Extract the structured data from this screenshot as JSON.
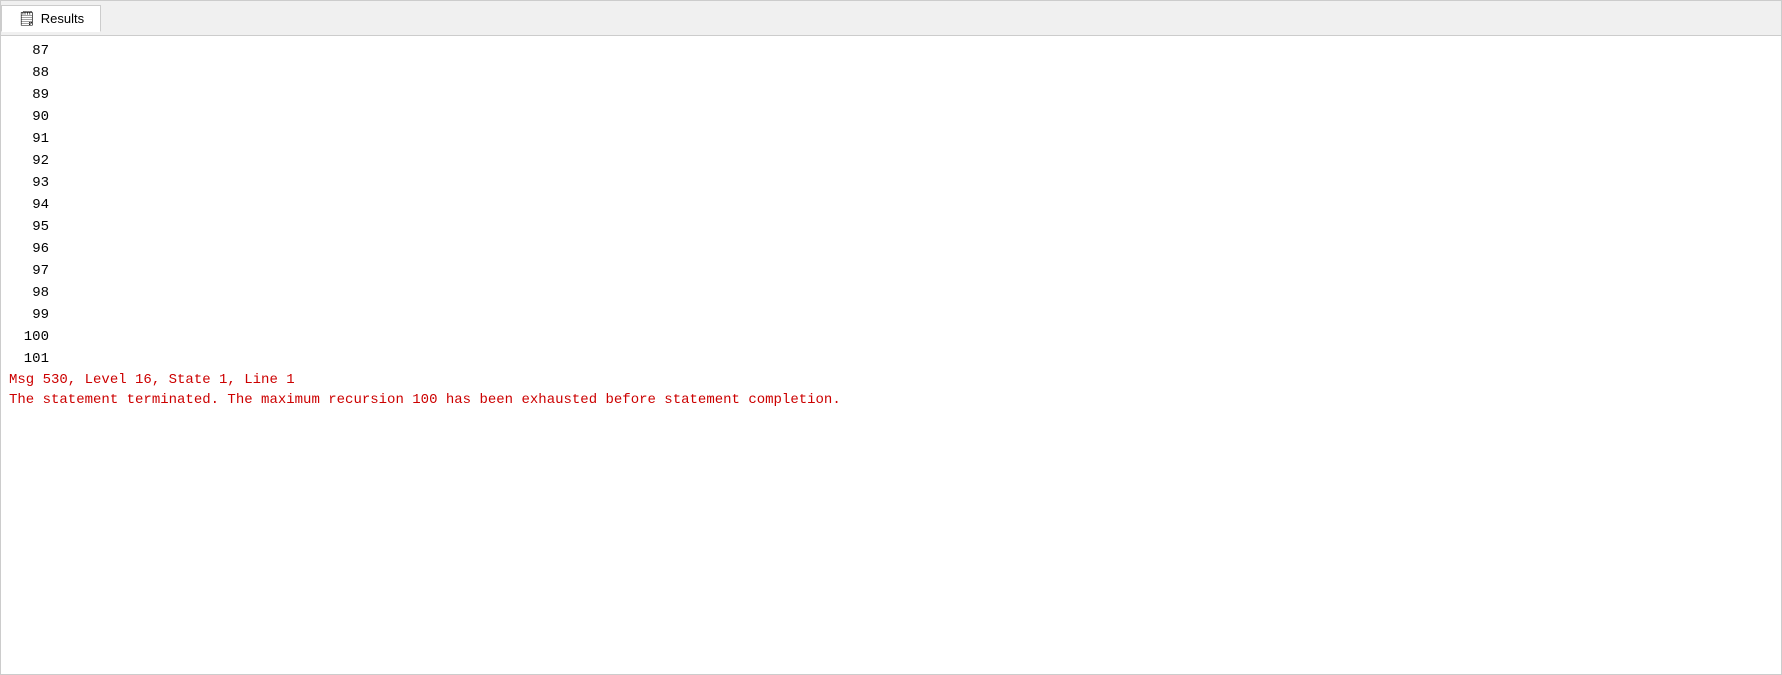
{
  "tab": {
    "icon": "📋",
    "label": "Results"
  },
  "lines": [
    {
      "number": "87"
    },
    {
      "number": "88"
    },
    {
      "number": "89"
    },
    {
      "number": "90"
    },
    {
      "number": "91"
    },
    {
      "number": "92"
    },
    {
      "number": "93"
    },
    {
      "number": "94"
    },
    {
      "number": "95"
    },
    {
      "number": "96"
    },
    {
      "number": "97"
    },
    {
      "number": "98"
    },
    {
      "number": "99"
    },
    {
      "number": "100"
    },
    {
      "number": "101"
    }
  ],
  "error": {
    "line1": "Msg 530, Level 16, State 1, Line 1",
    "line2": "The statement terminated. The maximum recursion 100 has been exhausted before statement completion."
  }
}
